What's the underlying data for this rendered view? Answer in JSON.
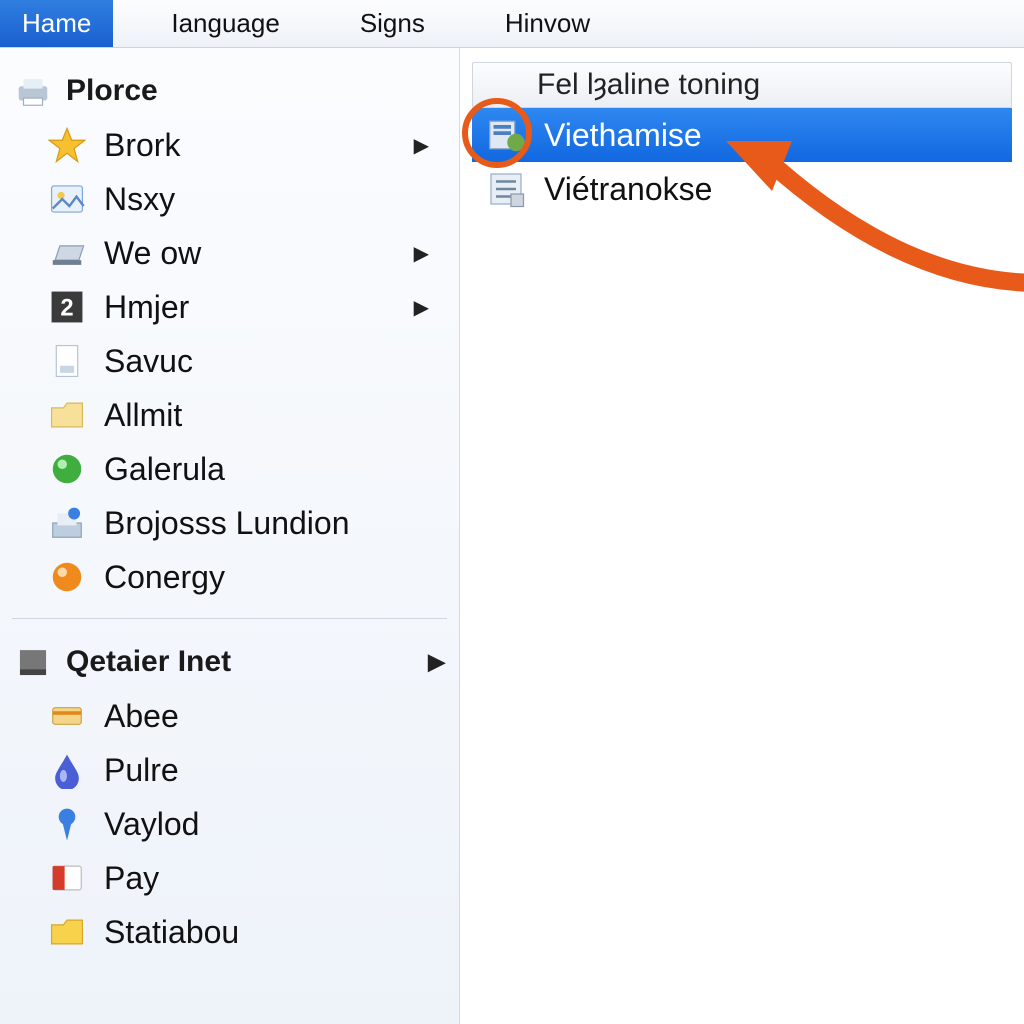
{
  "menubar": {
    "items": [
      {
        "label": "Hame",
        "active": true
      },
      {
        "label": "Ianguage"
      },
      {
        "label": "Signs"
      },
      {
        "label": "Hinvow"
      }
    ]
  },
  "sidebar": {
    "groups": [
      {
        "header": "Plorce",
        "header_icon": "printer-icon",
        "items": [
          {
            "label": "Brork",
            "icon": "star-icon",
            "submenu": true
          },
          {
            "label": "Nsxy",
            "icon": "photo-icon",
            "submenu": false
          },
          {
            "label": "We ow",
            "icon": "scanner-icon",
            "submenu": true
          },
          {
            "label": "Hmjer",
            "icon": "two-box-icon",
            "submenu": true
          },
          {
            "label": "Savuc",
            "icon": "page-icon",
            "submenu": false
          },
          {
            "label": "Allmit",
            "icon": "folder-icon",
            "submenu": false
          },
          {
            "label": "Galerula",
            "icon": "green-dot-icon",
            "submenu": false
          },
          {
            "label": "Brojosss Lundion",
            "icon": "inbox-pin-icon",
            "submenu": false
          },
          {
            "label": "Conergy",
            "icon": "orange-dot-icon",
            "submenu": false
          }
        ]
      },
      {
        "header": "Qetaier Inet",
        "header_icon": "drive-icon",
        "header_submenu": true,
        "items": [
          {
            "label": "Abee",
            "icon": "card-icon",
            "submenu": false
          },
          {
            "label": "Pulre",
            "icon": "drop-icon",
            "submenu": false
          },
          {
            "label": "Vaylod",
            "icon": "pin-icon",
            "submenu": false
          },
          {
            "label": "Pay",
            "icon": "red-card-icon",
            "submenu": false
          },
          {
            "label": "Statiabou",
            "icon": "folder-y-icon",
            "submenu": false
          }
        ]
      }
    ]
  },
  "content": {
    "column_header": "Fel lȝaline toning",
    "rows": [
      {
        "label": "Viethamise",
        "icon": "config-icon",
        "selected": true
      },
      {
        "label": "Viétranokse",
        "icon": "list-icon",
        "selected": false
      }
    ]
  },
  "annotation": {
    "circle_target": "row-0-icon",
    "arrow_target": "row-0"
  }
}
